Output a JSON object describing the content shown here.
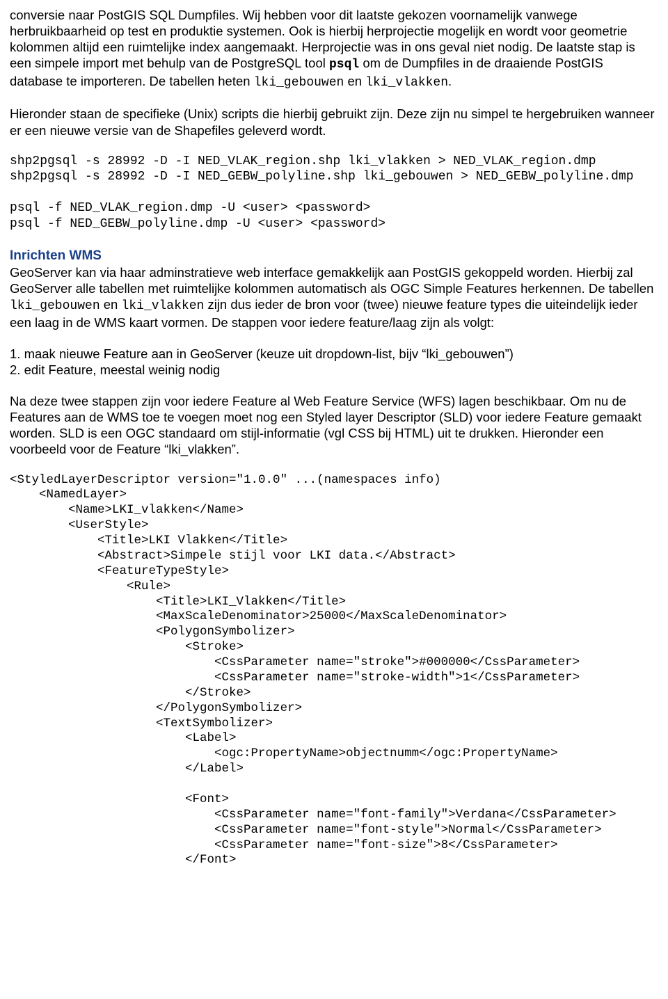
{
  "para1_a": "conversie naar PostGIS SQL Dumpfiles. Wij hebben voor dit laatste gekozen voornamelijk vanwege herbruikbaarheid op test en produktie systemen. Ook is hierbij herprojectie mogelijk en wordt voor geometrie kolommen altijd een ruimtelijke index aangemaakt. Herprojectie was in ons geval niet nodig. De laatste stap is een simpele import met behulp van de PostgreSQL tool ",
  "para1_psql": "psql",
  "para1_b": " om de Dumpfiles in de draaiende PostGIS database te importeren. De tabellen heten ",
  "para1_t1": "lki_gebouwen",
  "para1_en": " en ",
  "para1_t2": "lki_vlakken",
  "para1_dot": ".",
  "para2": "Hieronder staan de specifieke (Unix) scripts die hierbij gebruikt zijn. Deze zijn nu simpel te hergebruiken wanneer er een nieuwe versie van de Shapefiles geleverd wordt.",
  "code1": "shp2pgsql -s 28992 -D -I NED_VLAK_region.shp lki_vlakken > NED_VLAK_region.dmp\nshp2pgsql -s 28992 -D -I NED_GEBW_polyline.shp lki_gebouwen > NED_GEBW_polyline.dmp\n\npsql -f NED_VLAK_region.dmp -U <user> <password>\npsql -f NED_GEBW_polyline.dmp -U <user> <password>",
  "heading_wms": "Inrichten WMS",
  "para3_a": "GeoServer kan via haar adminstratieve web interface gemakkelijk aan PostGIS gekoppeld worden. Hierbij zal GeoServer alle tabellen met ruimtelijke kolommen automatisch als OGC Simple Features herkennen. De tabellen ",
  "para3_t1": "lki_gebouwen",
  "para3_en": " en ",
  "para3_t2": "lki_vlakken",
  "para3_b": " zijn dus ieder de bron voor (twee) nieuwe feature types die uiteindelijk ieder een laag in de WMS kaart vormen. De stappen voor iedere feature/laag zijn als volgt:",
  "step1": "1. maak nieuwe Feature aan in GeoServer (keuze uit dropdown-list, bijv “lki_gebouwen”)",
  "step2": "2. edit Feature, meestal weinig nodig",
  "para4": "Na deze twee stappen zijn voor iedere Feature al Web Feature Service (WFS) lagen beschikbaar. Om nu de Features aan de WMS toe te voegen moet nog een Styled layer Descriptor (SLD) voor iedere Feature gemaakt worden. SLD is een OGC standaard om stijl-informatie (vgl CSS bij HTML) uit te drukken. Hieronder een voorbeeld voor de Feature “lki_vlakken”.",
  "xml": "<StyledLayerDescriptor version=\"1.0.0\" ...(namespaces info)\n    <NamedLayer>\n        <Name>LKI_vlakken</Name>\n        <UserStyle>\n            <Title>LKI Vlakken</Title>\n            <Abstract>Simpele stijl voor LKI data.</Abstract>\n            <FeatureTypeStyle>\n                <Rule>\n                    <Title>LKI_Vlakken</Title>\n                    <MaxScaleDenominator>25000</MaxScaleDenominator>\n                    <PolygonSymbolizer>\n                        <Stroke>\n                            <CssParameter name=\"stroke\">#000000</CssParameter>\n                            <CssParameter name=\"stroke-width\">1</CssParameter>\n                        </Stroke>\n                    </PolygonSymbolizer>\n                    <TextSymbolizer>\n                        <Label>\n                            <ogc:PropertyName>objectnumm</ogc:PropertyName>\n                        </Label>\n\n                        <Font>\n                            <CssParameter name=\"font-family\">Verdana</CssParameter>\n                            <CssParameter name=\"font-style\">Normal</CssParameter>\n                            <CssParameter name=\"font-size\">8</CssParameter>\n                        </Font>"
}
